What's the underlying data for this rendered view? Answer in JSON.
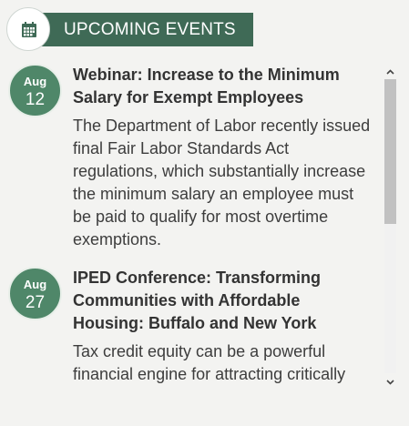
{
  "header": {
    "title": "UPCOMING EVENTS",
    "icon": "calendar-icon"
  },
  "colors": {
    "accent": "#3f6a56",
    "badge": "#4f8769",
    "background": "#f3f3f1"
  },
  "events": [
    {
      "month": "Aug",
      "day": "12",
      "title": "Webinar: Increase to the Minimum Salary for Exempt Employees",
      "description": "The Department of Labor recently issued final Fair Labor Standards Act regulations, which substantially increase the minimum salary an employee must be paid to qualify for most overtime exemptions."
    },
    {
      "month": "Aug",
      "day": "27",
      "title": "IPED Conference: Transforming Communities with Affordable Housing: Buffalo and New York",
      "description": "Tax credit equity can be a powerful financial engine for attracting critically needed private capital for Historic"
    }
  ],
  "scrollbar": {
    "up_icon": "chevron-up-icon",
    "down_icon": "chevron-down-icon"
  }
}
